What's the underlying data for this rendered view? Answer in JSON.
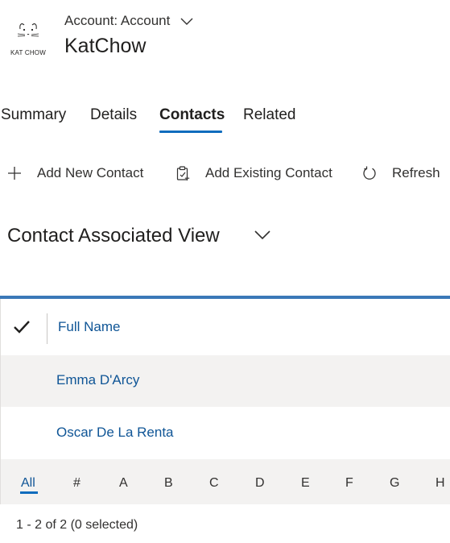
{
  "header": {
    "logo_text": "KAT CHOW",
    "record_type": "Account: Account",
    "record_name": "KatChow"
  },
  "tabs": [
    {
      "label": "Summary",
      "active": false
    },
    {
      "label": "Details",
      "active": false
    },
    {
      "label": "Contacts",
      "active": true
    },
    {
      "label": "Related",
      "active": false
    }
  ],
  "commands": {
    "add_new": {
      "label": "Add New Contact",
      "icon": "plus-icon"
    },
    "add_existing": {
      "label": "Add Existing Contact",
      "icon": "clipboard-add-icon"
    },
    "refresh": {
      "label": "Refresh",
      "icon": "refresh-icon"
    }
  },
  "view": {
    "title": "Contact Associated View"
  },
  "grid": {
    "columns": [
      "Full Name"
    ],
    "rows": [
      {
        "full_name": "Emma D'Arcy"
      },
      {
        "full_name": "Oscar De La Renta"
      }
    ]
  },
  "jump_bar": {
    "items": [
      "All",
      "#",
      "A",
      "B",
      "C",
      "D",
      "E",
      "F",
      "G",
      "H"
    ],
    "selected": "All"
  },
  "status": "1 - 2 of 2 (0 selected)",
  "colors": {
    "accent": "#0f6cbd",
    "link": "#0f5596",
    "grid_top_bar": "#3b78b8",
    "row_alt_bg": "#f3f2f1"
  }
}
